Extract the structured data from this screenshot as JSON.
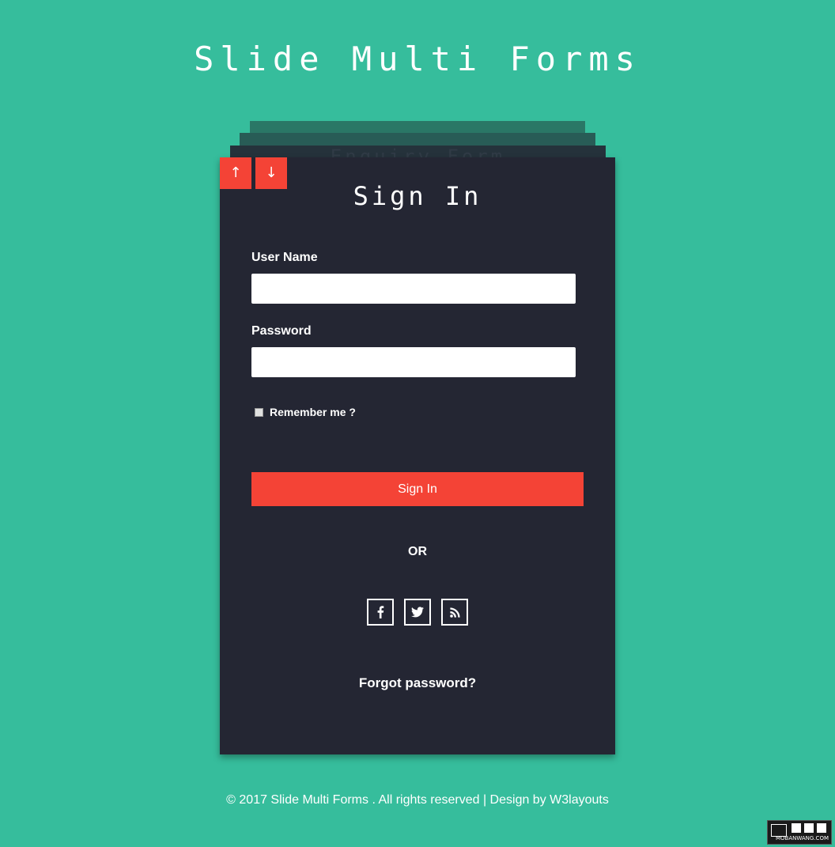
{
  "header": {
    "title": "Slide Multi Forms"
  },
  "stack": {
    "behind_title": "Enquiry Form"
  },
  "nav": {
    "up_label": "↑",
    "down_label": "↓"
  },
  "form": {
    "title": "Sign In",
    "username_label": "User Name",
    "username_value": "",
    "password_label": "Password",
    "password_value": "",
    "remember_label": "Remember me ?",
    "remember_checked": false,
    "submit_label": "Sign In",
    "or_text": "OR",
    "social_icons": [
      "facebook-icon",
      "twitter-icon",
      "rss-icon"
    ],
    "forgot_label": "Forgot password?"
  },
  "footer": {
    "text": "© 2017 Slide Multi Forms . All rights reserved | Design by W3layouts"
  },
  "watermark": {
    "text": "MOBANWANG.COM"
  },
  "colors": {
    "background": "#36bd9c",
    "card": "#242633",
    "accent": "#f44336",
    "text": "#ffffff"
  }
}
